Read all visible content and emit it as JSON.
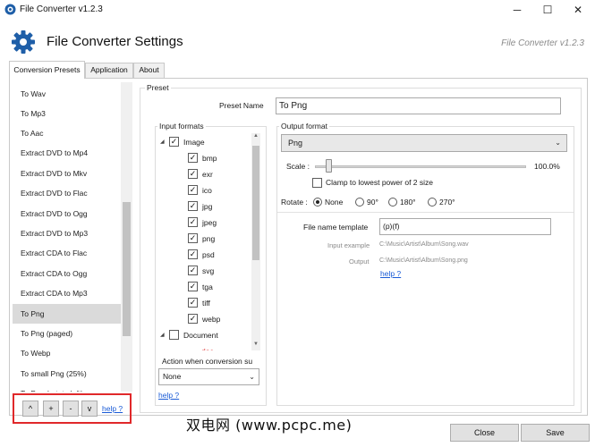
{
  "window": {
    "title": "File Converter v1.2.3",
    "controls": {
      "minimize": "─",
      "maximize": "☐",
      "close": "✕"
    }
  },
  "header": {
    "title": "File Converter Settings",
    "version": "File Converter v1.2.3",
    "icon": "gear-icon",
    "accent_color": "#1f5fa8"
  },
  "tabs": [
    {
      "label": "Conversion Presets",
      "active": true
    },
    {
      "label": "Application",
      "active": false
    },
    {
      "label": "About",
      "active": false
    }
  ],
  "presets": {
    "items": [
      "To Wav",
      "To Mp3",
      "To Aac",
      "Extract DVD to Mp4",
      "Extract DVD to Mkv",
      "Extract DVD to Flac",
      "Extract DVD to Ogg",
      "Extract DVD to Mp3",
      "Extract CDA to Flac",
      "Extract CDA to Ogg",
      "Extract CDA to Mp3",
      "To Png",
      "To Png (paged)",
      "To Webp",
      "To small Png (25%)",
      "To Png (rotate left)"
    ],
    "selected": "To Png",
    "buttons": {
      "up": "^",
      "add": "+",
      "remove": "-",
      "down": "v"
    },
    "help": "help ?"
  },
  "preset_group": {
    "legend": "Preset",
    "name_label": "Preset Name",
    "name_value": "To Png"
  },
  "input_formats": {
    "legend": "Input formats",
    "image_group": "Image",
    "image_formats": [
      "bmp",
      "exr",
      "ico",
      "jpg",
      "jpeg",
      "png",
      "psd",
      "svg",
      "tga",
      "tiff",
      "webp"
    ],
    "document_group": "Document",
    "document_first_child": "doc",
    "action_label": "Action when conversion su",
    "action_value": "None",
    "help": "help ?"
  },
  "output_format": {
    "legend": "Output format",
    "format": "Png",
    "scale_label": "Scale :",
    "scale_value": "100.0%",
    "clamp_label": "Clamp to lowest power of 2 size",
    "clamp_checked": false,
    "rotate_label": "Rotate :",
    "rotate_options": [
      "None",
      "90°",
      "180°",
      "270°"
    ],
    "rotate_selected": "None",
    "template_label": "File name template",
    "template_value": "(p)(f)",
    "input_example_label": "Input example",
    "input_example_value": "C:\\Music\\Artist\\Album\\Song.wav",
    "output_label": "Output",
    "output_value": "C:\\Music\\Artist\\Album\\Song.png",
    "help": "help ?"
  },
  "footer": {
    "close": "Close",
    "save": "Save"
  },
  "watermark": "双电网 (www.pcpc.me)",
  "colors": {
    "link": "#1a5bd6",
    "highlight_box": "#e0282a",
    "selected_row": "#dadada"
  }
}
